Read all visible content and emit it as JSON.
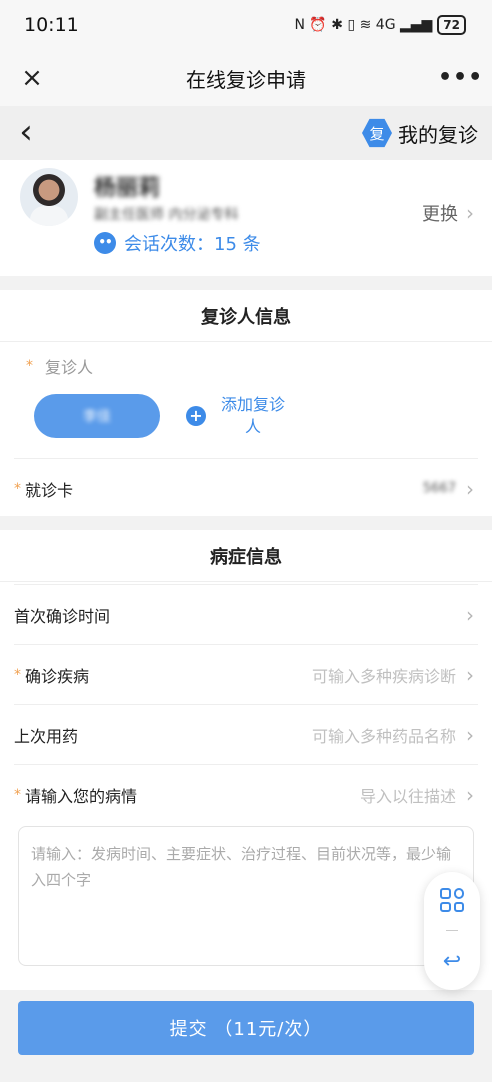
{
  "status_bar": {
    "time": "10:11",
    "icons": "N ⏰ ✱ ▯ ≋ 4G ▂▄▆",
    "battery": "72"
  },
  "titlebar": {
    "close_icon": "×",
    "title": "在线复诊申请",
    "more_icon": "•••"
  },
  "nav": {
    "back_icon": "‹",
    "badge": "复",
    "my_followup": "我的复诊"
  },
  "doctor": {
    "name": "杨丽莉",
    "dept": "副主任医师 内分泌专科",
    "session_label": "会话次数：15 条",
    "change_label": "更换",
    "chevron": "›"
  },
  "patient_section": {
    "title": "复诊人信息",
    "required_mark": "*",
    "patient_label": "复诊人",
    "patient_name": "李佳",
    "add_label": "添加复诊人",
    "card_label": "就诊卡",
    "card_value": "5667"
  },
  "disease_section": {
    "title": "病症信息",
    "first_diagnosis_label": "首次确诊时间",
    "confirmed_disease_label": "确诊疾病",
    "confirmed_disease_placeholder": "可输入多种疾病诊断",
    "last_medication_label": "上次用药",
    "last_medication_placeholder": "可输入多种药品名称",
    "condition_label": "请输入您的病情",
    "import_label": "导入以往描述",
    "textarea_placeholder": "请输入：发病时间、主要症状、治疗过程、目前状况等，最少输入四个字"
  },
  "float_panel": {
    "back_icon": "↩"
  },
  "submit": {
    "label": "提交 （11元/次）"
  },
  "colors": {
    "accent": "#3d8be8",
    "button": "#5a9bea",
    "required": "#f0a050"
  }
}
